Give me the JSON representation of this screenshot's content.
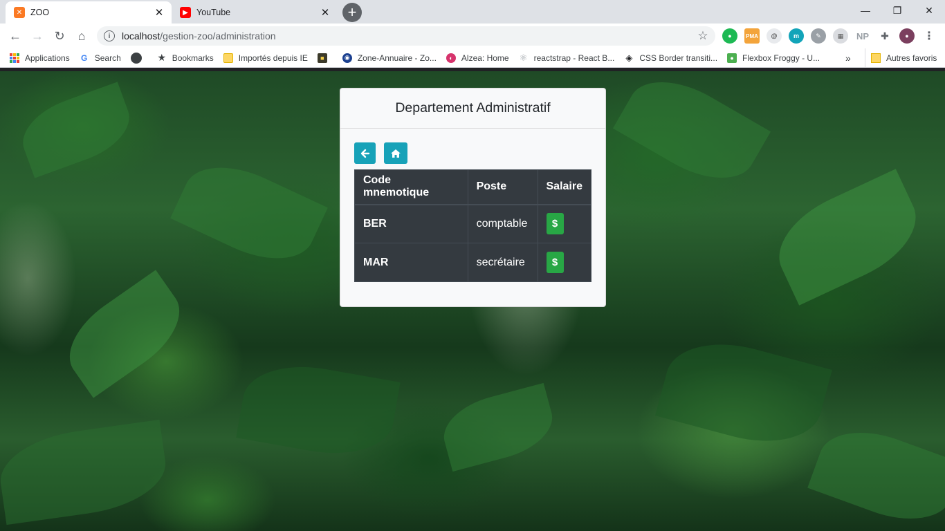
{
  "browser": {
    "tabs": [
      {
        "label": "ZOO",
        "favicon": "xampp-icon",
        "active": true
      },
      {
        "label": "YouTube",
        "favicon": "youtube-icon",
        "active": false
      }
    ],
    "url": {
      "host": "localhost",
      "path": "/gestion-zoo/administration"
    },
    "bookmarks": [
      {
        "label": "Applications",
        "icon": "apps-grid-icon"
      },
      {
        "label": "Search",
        "icon": "google-icon"
      },
      {
        "label": "",
        "icon": "circle-icon"
      },
      {
        "label": "Bookmarks",
        "icon": "star-icon"
      },
      {
        "label": "Importés depuis IE",
        "icon": "folder-icon"
      },
      {
        "label": "",
        "icon": "app-icon"
      },
      {
        "label": "Zone-Annuaire - Zo...",
        "icon": "globe-icon"
      },
      {
        "label": "Alzea: Home",
        "icon": "alzea-icon"
      },
      {
        "label": "reactstrap - React B...",
        "icon": "react-icon"
      },
      {
        "label": "CSS Border transiti...",
        "icon": "codepen-icon"
      },
      {
        "label": "Flexbox Froggy - U...",
        "icon": "frog-icon"
      }
    ],
    "bookmarks_overflow": "»",
    "other_bookmarks": "Autres favoris",
    "extensions": [
      "green-extension-icon",
      "pma-extension-icon",
      "mail-extension-icon",
      "m-extension-icon",
      "eyedropper-extension-icon",
      "grid-extension-icon",
      "np-extension-icon",
      "puzzle-icon",
      "profile-avatar"
    ]
  },
  "page": {
    "title": "Departement Administratif",
    "back_button": "back-arrow",
    "home_button": "home",
    "table": {
      "headers": [
        "Code mnemotique",
        "Poste",
        "Salaire"
      ],
      "rows": [
        {
          "code": "BER",
          "poste": "comptable",
          "salaire_button": "$"
        },
        {
          "code": "MAR",
          "poste": "secrétaire",
          "salaire_button": "$"
        }
      ]
    }
  },
  "colors": {
    "info_button": "#17a2b8",
    "success_button": "#28a745",
    "table_dark": "#343a40"
  }
}
